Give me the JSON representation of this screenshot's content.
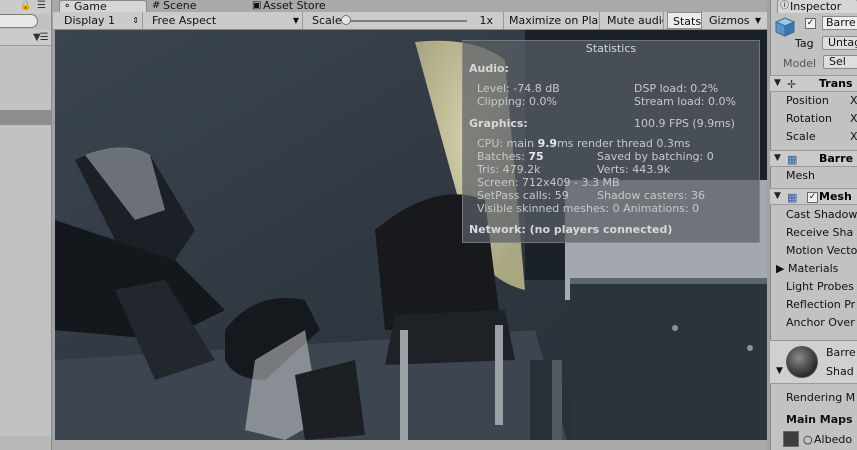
{
  "hierarchy": {
    "lock_icon": "lock-icon",
    "menu_icon": "menu-icon"
  },
  "tabs": [
    {
      "label": "Game",
      "icon": "game-icon"
    },
    {
      "label": "Scene",
      "icon": "scene-grid-icon"
    },
    {
      "label": "Asset Store",
      "icon": "asset-store-icon"
    }
  ],
  "toolbar": {
    "display": "Display 1",
    "aspect": "Free Aspect",
    "scale_label": "Scale",
    "scale_value": "1x",
    "maximize": "Maximize on Play",
    "mute": "Mute audio",
    "stats": "Stats",
    "gizmos": "Gizmos"
  },
  "stats": {
    "title": "Statistics",
    "audio_header": "Audio:",
    "level": "Level: -74.8 dB",
    "dsp": "DSP load: 0.2%",
    "clipping": "Clipping: 0.0%",
    "stream": "Stream load: 0.0%",
    "graphics_header": "Graphics:",
    "fps": "100.9 FPS (9.9ms)",
    "cpu_prefix": "CPU: main ",
    "cpu_main": "9.9",
    "cpu_suffix": "ms  render thread 0.3ms",
    "batches_prefix": "Batches: ",
    "batches": "75",
    "saved_batching": "Saved by batching: 0",
    "tris": "Tris: 479.2k",
    "verts": "Verts: 443.9k",
    "screen": "Screen: 712x409 - 3.3 MB",
    "setpass": "SetPass calls: 59",
    "shadow_casters": "Shadow casters: 36",
    "skinned": "Visible skinned meshes: 0  Animations: 0",
    "network": "Network: (no players connected)"
  },
  "inspector": {
    "tab_label": "Inspector",
    "tab_icon": "info-icon",
    "object_name": "Barre",
    "tag_label": "Tag",
    "tag_value": "Untag",
    "model_label": "Model",
    "model_select": "Sel",
    "transform": {
      "title": "Trans",
      "position": "Position",
      "rotation": "Rotation",
      "scale": "Scale",
      "x": "X"
    },
    "mesh_filter": {
      "title": "Barre",
      "mesh_label": "Mesh"
    },
    "mesh_renderer": {
      "title": "Mesh",
      "cast_shadows": "Cast Shadow",
      "receive_shadows": "Receive Sha",
      "motion_vectors": "Motion Vecto",
      "materials": "Materials",
      "light_probes": "Light Probes",
      "reflection_probes": "Reflection Pr",
      "anchor_override": "Anchor Over"
    },
    "material": {
      "name": "Barre",
      "shader": "Shad"
    },
    "rendering_mode": "Rendering M",
    "main_maps": "Main Maps",
    "albedo": "Albedo"
  }
}
